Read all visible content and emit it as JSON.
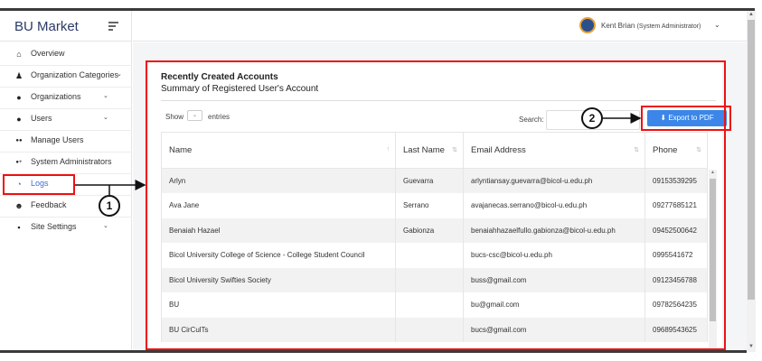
{
  "sidebar": {
    "brand": "BU Market",
    "items": [
      {
        "label": "Overview",
        "icon": "home-icon",
        "chevron": false
      },
      {
        "label": "Organization Categories",
        "icon": "shirt-icon",
        "chevron": true
      },
      {
        "label": "Organizations",
        "icon": "user-icon",
        "chevron": true
      },
      {
        "label": "Users",
        "icon": "user-icon",
        "chevron": true
      },
      {
        "label": "Manage Users",
        "icon": "users-icon",
        "chevron": false
      },
      {
        "label": "System Administrators",
        "icon": "user-plus-icon",
        "chevron": false
      },
      {
        "label": "Logs",
        "icon": "pie-chart-icon",
        "chevron": false,
        "active": true
      },
      {
        "label": "Feedback",
        "icon": "smile-icon",
        "chevron": false
      },
      {
        "label": "Site Settings",
        "icon": "settings-icon",
        "chevron": true
      }
    ]
  },
  "header": {
    "user_name": "Kent Brian",
    "user_role": "(System Administrator)",
    "chevron": "⌄"
  },
  "card": {
    "title": "Recently Created Accounts",
    "subtitle": "Summary of Registered User's Account",
    "show_label": "Show",
    "show_value": "",
    "entries_label": "entries",
    "search_label": "Search:",
    "search_value": "",
    "export_label": "Export to PDF"
  },
  "table": {
    "columns": [
      "Name",
      "Last Name",
      "Email Address",
      "Phone"
    ],
    "rows": [
      [
        "Arlyn",
        "Guevarra",
        "arlyntiansay.guevarra@bicol-u.edu.ph",
        "09153539295"
      ],
      [
        "Ava Jane",
        "Serrano",
        "avajanecas.serrano@bicol-u.edu.ph",
        "09277685121"
      ],
      [
        "Benaiah Hazael",
        "Gabionza",
        "benaiahhazaelfullo.gabionza@bicol-u.edu.ph",
        "09452500642"
      ],
      [
        "Bicol University College of Science - College Student Council",
        "",
        "bucs-csc@bicol-u.edu.ph",
        "0995541672"
      ],
      [
        "Bicol University Swifties Society",
        "",
        "buss@gmail.com",
        "09123456788"
      ],
      [
        "BU",
        "",
        "bu@gmail.com",
        "09782564235"
      ],
      [
        "BU CirCulTs",
        "",
        "bucs@gmail.com",
        "09689543625"
      ]
    ]
  },
  "callouts": [
    "1",
    "2"
  ],
  "colors": {
    "accent": "#3f6ad8",
    "export_button": "#3b86e8",
    "highlight": "#ee1111",
    "brand_text": "#2b3a67"
  }
}
